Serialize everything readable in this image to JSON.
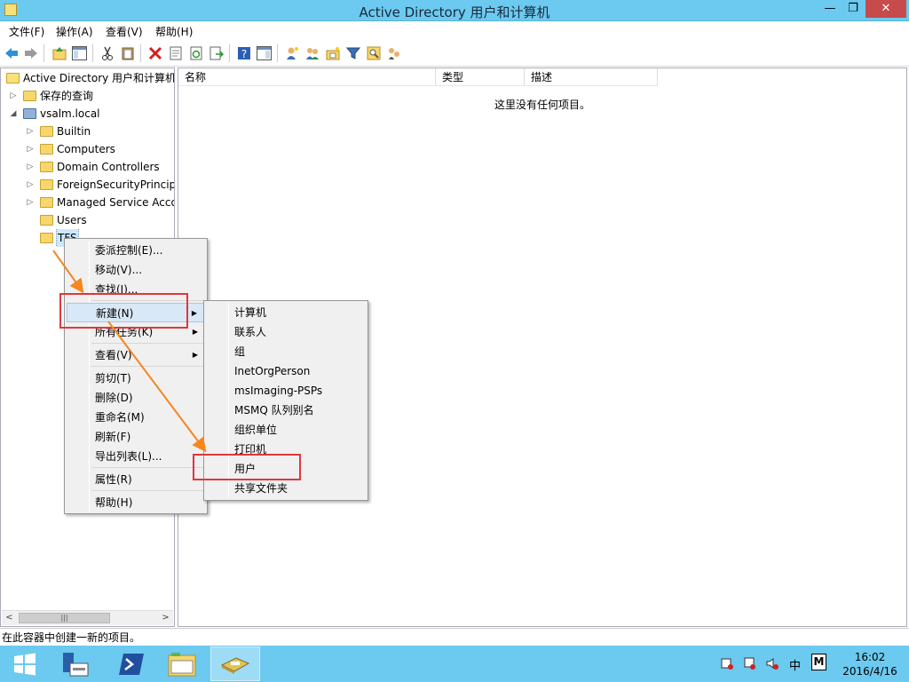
{
  "window": {
    "title": "Active Directory 用户和计算机",
    "min_glyph": "—",
    "max_glyph": "❐",
    "close_glyph": "✕"
  },
  "menubar": [
    "文件(F)",
    "操作(A)",
    "查看(V)",
    "帮助(H)"
  ],
  "toolbar_icons": [
    "back-icon",
    "forward-icon",
    "up-icon",
    "show-tree-icon",
    "cut-icon",
    "paste-icon",
    "delete-icon",
    "properties-icon",
    "refresh-icon",
    "export-icon",
    "help-icon",
    "console-icon",
    "new-user-icon",
    "new-group-icon",
    "new-ou-icon",
    "filter-icon",
    "find-icon",
    "add-to-group-icon"
  ],
  "tree": {
    "root": "Active Directory 用户和计算机",
    "saved_queries": "保存的查询",
    "domain": "vsalm.local",
    "children": [
      "Builtin",
      "Computers",
      "Domain Controllers",
      "ForeignSecurityPrincipals",
      "Managed Service Accounts",
      "Users",
      "TFS"
    ]
  },
  "list": {
    "columns": [
      "名称",
      "类型",
      "描述"
    ],
    "empty_text": "这里没有任何项目。"
  },
  "context_menu": {
    "items": [
      "委派控制(E)...",
      "移动(V)...",
      "查找(I)...",
      "新建(N)",
      "所有任务(K)",
      "查看(V)",
      "剪切(T)",
      "删除(D)",
      "重命名(M)",
      "刷新(F)",
      "导出列表(L)...",
      "属性(R)",
      "帮助(H)"
    ]
  },
  "submenu": {
    "items": [
      "计算机",
      "联系人",
      "组",
      "InetOrgPerson",
      "msImaging-PSPs",
      "MSMQ 队列别名",
      "组织单位",
      "打印机",
      "用户",
      "共享文件夹"
    ]
  },
  "status": "在此容器中创建一新的项目。",
  "taskbar": {
    "tray": [
      "中",
      "M"
    ],
    "time": "16:02",
    "date": "2016/4/16"
  },
  "colors": {
    "titlebar": "#6cc9ef",
    "highlight_box": "#e0373b",
    "arrow": "#f5871f"
  }
}
